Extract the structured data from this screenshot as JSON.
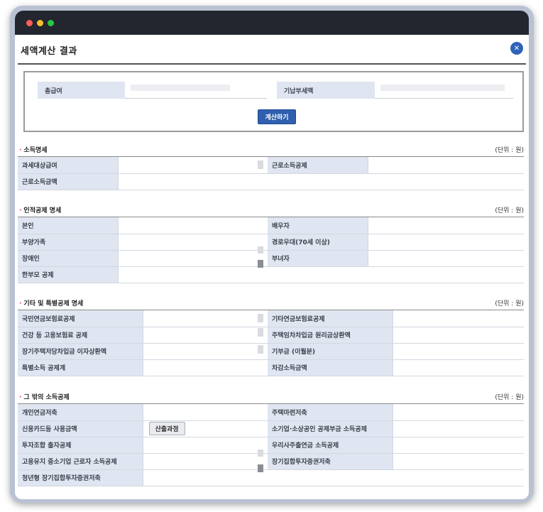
{
  "window": {
    "title": "세액계산 결과",
    "close_icon": "close-icon"
  },
  "input": {
    "total_salary_label": "총급여",
    "total_salary_value": "",
    "paid_tax_label": "기납부세액",
    "paid_tax_value": "",
    "calculate_button": "계산하기"
  },
  "sections": {
    "income": {
      "title": "소득명세",
      "unit": "(단위 : 원)",
      "rows": [
        [
          "과세대상급여",
          "",
          "근로소득공제",
          ""
        ],
        [
          "근로소득금액",
          "",
          "",
          ""
        ]
      ]
    },
    "personal": {
      "title": "인적공제 명세",
      "unit": "(단위 : 원)",
      "rows": [
        [
          "본인",
          "",
          "배우자",
          ""
        ],
        [
          "부양가족",
          "",
          "경로우대(70세 이상)",
          ""
        ],
        [
          "장애인",
          "",
          "부녀자",
          ""
        ],
        [
          "한부모 공제",
          "",
          "",
          ""
        ]
      ]
    },
    "special": {
      "title": "기타 및 특별공제 명세",
      "unit": "(단위 : 원)",
      "rows": [
        [
          "국민연금보험료공제",
          "",
          "기타연금보험료공제",
          ""
        ],
        [
          "건강 등 고용보험료 공제",
          "",
          "주택임차차입금 원리금상환액",
          ""
        ],
        [
          "장기주택저당차입금 이자상환액",
          "",
          "기부금 (이월분)",
          ""
        ],
        [
          "특별소득 공제계",
          "",
          "차감소득금액",
          ""
        ]
      ]
    },
    "other": {
      "title": "그 밖의 소득공제",
      "unit": "(단위 : 원)",
      "calc_process_button": "산출과정",
      "rows": [
        [
          "개인연금저축",
          "",
          "주택마련저축",
          ""
        ],
        [
          "신용카드등 사용금액",
          "",
          "소기업·소상공인 공제부금 소득공제",
          ""
        ],
        [
          "투자조합 출자공제",
          "",
          "우리사주출연금 소득공제",
          ""
        ],
        [
          "고용유지 중소기업 근로자 소득공제",
          "",
          "장기집합투자증권저축",
          ""
        ],
        [
          "청년형 장기집합투자증권저축",
          "",
          "",
          ""
        ]
      ]
    }
  }
}
